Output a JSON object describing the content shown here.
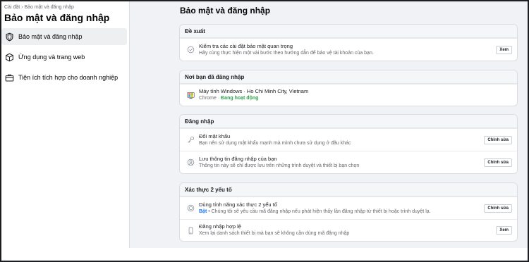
{
  "breadcrumb": {
    "parent": "Cài đặt",
    "separator": "›",
    "current": "Bảo mật và đăng nhập"
  },
  "sidebar": {
    "title": "Bảo mật và đăng nhập",
    "items": [
      {
        "label": "Bảo mật và đăng nhập",
        "icon": "shield-icon",
        "active": true
      },
      {
        "label": "Ứng dụng và trang web",
        "icon": "cube-icon",
        "active": false
      },
      {
        "label": "Tiện ích tích hợp cho doanh nghiệp",
        "icon": "briefcase-icon",
        "active": false
      }
    ]
  },
  "main": {
    "title": "Bảo mật và đăng nhập",
    "sections": [
      {
        "header": "Đề xuất",
        "rows": [
          {
            "icon": "check-circle-icon",
            "title": "Kiểm tra các cài đặt bảo mật quan trọng",
            "subtitle": "Hãy cùng thực hiện một vài bước theo hướng dẫn để bảo vệ tài khoản của bạn.",
            "button": "Xem"
          }
        ]
      },
      {
        "header": "Nơi bạn đã đăng nhập",
        "rows": [
          {
            "icon": "windows-computer-icon",
            "title": "Máy tính Windows · Ho Chi Minh City, Vietnam",
            "subtitle_prefix": "Chrome · ",
            "subtitle_status": "Đang hoạt động"
          }
        ]
      },
      {
        "header": "Đăng nhập",
        "rows": [
          {
            "icon": "key-icon",
            "title": "Đổi mật khẩu",
            "subtitle": "Bạn nên sử dụng mật khẩu mạnh mà mình chưa sử dụng ở đâu khác",
            "button": "Chỉnh sửa"
          },
          {
            "icon": "user-circle-icon",
            "title": "Lưu thông tin đăng nhập của bạn",
            "subtitle": "Thông tin này sẽ chỉ được lưu trên những trình duyệt và thiết bị bạn chọn",
            "button": "Chỉnh sửa"
          }
        ]
      },
      {
        "header": "Xác thực 2 yếu tố",
        "rows": [
          {
            "icon": "shield-lock-icon",
            "title": "Dùng tính năng xác thực 2 yếu tố",
            "subtitle_on": "Bật",
            "subtitle": " • Chúng tôi sẽ yêu cầu mã đăng nhập nếu phát hiện thấy lần đăng nhập từ thiết bị hoặc trình duyệt lạ.",
            "button": "Chỉnh sửa"
          },
          {
            "icon": "phone-icon",
            "title": "Đăng nhập hợp lệ",
            "subtitle": "Xem lại danh sách thiết bị mà bạn sẽ không cần dùng mã đăng nhập",
            "button": "Xem"
          }
        ]
      }
    ]
  },
  "colors": {
    "active_status": "#31a24c",
    "on_status": "#1877f2",
    "windows_blue": "#0078d7"
  }
}
